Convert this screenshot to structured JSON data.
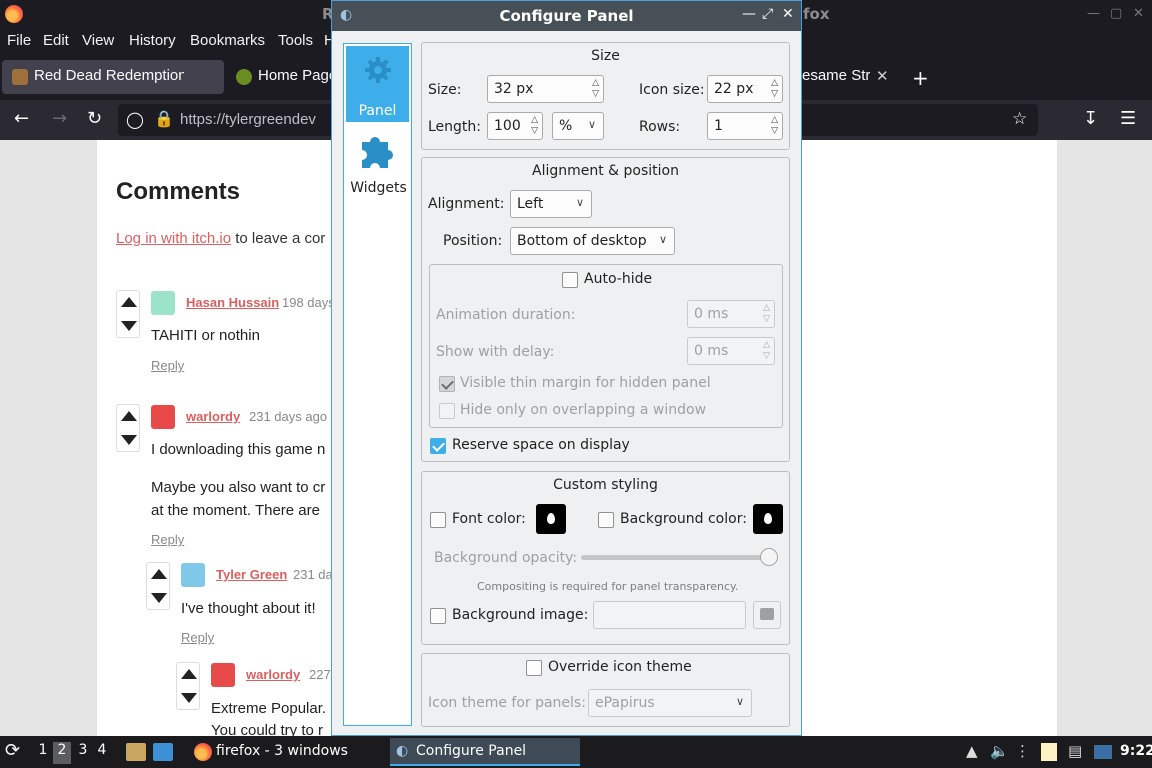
{
  "firefox": {
    "title_left": "R",
    "title_right": "fox",
    "menu": [
      "File",
      "Edit",
      "View",
      "History",
      "Bookmarks",
      "Tools",
      "H"
    ],
    "tabs": [
      {
        "label": "Red Dead Redemption C",
        "active": true
      },
      {
        "label": "Home Page",
        "active": false
      },
      {
        "label": "esame Str",
        "active": false
      }
    ],
    "url": "https://tylergreendev"
  },
  "page": {
    "heading": "Comments",
    "login_link": "Log in with itch.io",
    "login_rest": " to leave a cor",
    "comments": [
      {
        "author": "Hasan Hussain",
        "date": "198 days",
        "lines": [
          "TAHITI or nothin"
        ],
        "reply": "Reply"
      },
      {
        "author": "warlordy",
        "date": "231 days ago",
        "lines": [
          "I downloading this game n",
          "",
          "Maybe you also want to cr",
          "at the moment. There are"
        ],
        "reply": "Reply"
      },
      {
        "author": "Tyler Green",
        "date": "231 da",
        "lines": [
          "I've thought about it!"
        ],
        "reply": "Reply"
      },
      {
        "author": "warlordy",
        "date": "227",
        "lines": [
          "Extreme Popular.",
          "You could try to r"
        ],
        "reply": ""
      }
    ]
  },
  "dialog": {
    "title": "Configure Panel",
    "sidebar": [
      {
        "label": "Panel",
        "icon": "gear-icon",
        "selected": true
      },
      {
        "label": "Widgets",
        "icon": "puzzle-icon",
        "selected": false
      }
    ],
    "size": {
      "title": "Size",
      "size_label": "Size:",
      "size_value": "32 px",
      "icon_size_label": "Icon size:",
      "icon_size_value": "22 px",
      "length_label": "Length:",
      "length_value": "100",
      "length_unit": "%",
      "rows_label": "Rows:",
      "rows_value": "1"
    },
    "alignment": {
      "title": "Alignment & position",
      "alignment_label": "Alignment:",
      "alignment_value": "Left",
      "position_label": "Position:",
      "position_value": "Bottom of desktop",
      "autohide_label": "Auto-hide",
      "anim_label": "Animation duration:",
      "anim_value": "0 ms",
      "delay_label": "Show with delay:",
      "delay_value": "0 ms",
      "thin_margin_label": "Visible thin margin for hidden panel",
      "overlap_label": "Hide only on overlapping a window",
      "reserve_label": "Reserve space on display"
    },
    "styling": {
      "title": "Custom styling",
      "font_color_label": "Font color:",
      "bg_color_label": "Background color:",
      "opacity_label": "Background opacity:",
      "opacity_value": 1.0,
      "compositing_note": "Compositing is required for panel transparency.",
      "bg_image_label": "Background image:"
    },
    "icons": {
      "override_label": "Override icon theme",
      "theme_label": "Icon theme for panels:",
      "theme_value": "ePapirus"
    }
  },
  "taskbar": {
    "workspaces": [
      "1",
      "2",
      "3",
      "4"
    ],
    "active_workspace": "2",
    "tasks": [
      {
        "label": "firefox - 3 windows",
        "active": false
      },
      {
        "label": "Configure Panel",
        "active": true
      }
    ],
    "clock": "9:22"
  }
}
